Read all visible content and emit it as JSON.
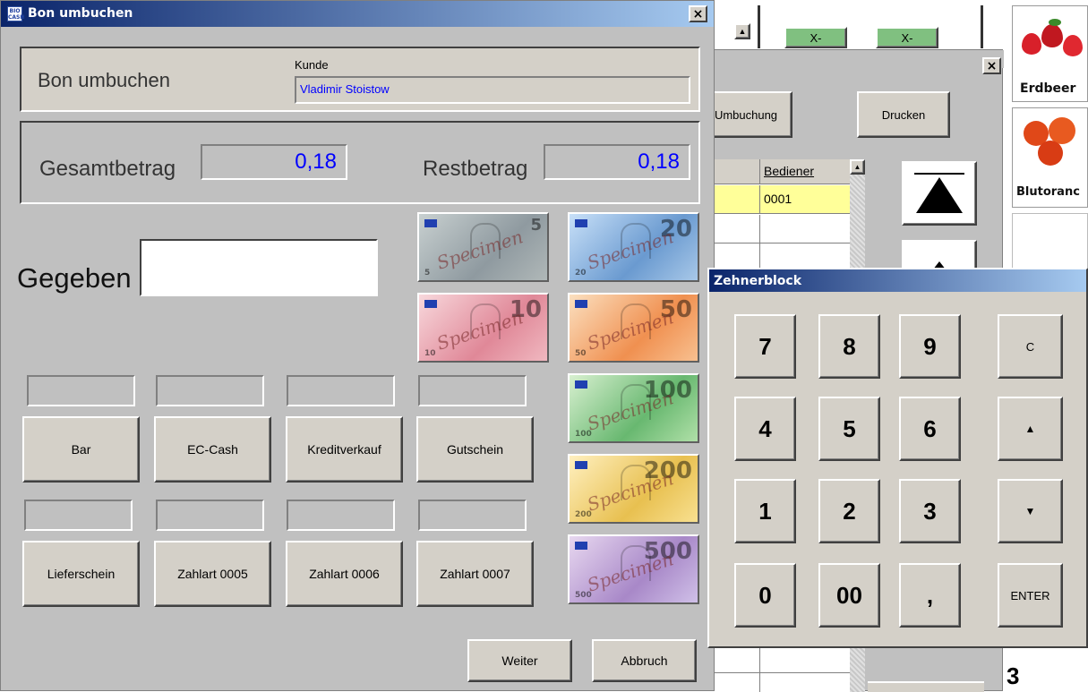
{
  "dialog": {
    "title": "Bon umbuchen",
    "logo": "BIO CASH",
    "close_symbol": "×",
    "heading": "Bon umbuchen",
    "customer_label": "Kunde",
    "customer_value": "Vladimir Stoistow",
    "total_label": "Gesamtbetrag",
    "total_value": "0,18",
    "rest_label": "Restbetrag",
    "rest_value": "0,18",
    "given_label": "Gegeben",
    "given_value": "",
    "payment_row1": [
      "Bar",
      "EC-Cash",
      "Kreditverkauf",
      "Gutschein"
    ],
    "payment_row2": [
      "Lieferschein",
      "Zahlart 0005",
      "Zahlart 0006",
      "Zahlart 0007"
    ],
    "banknotes": [
      {
        "value": "5",
        "label": "5 euro note",
        "color": "#9aa6a8",
        "overlay": "Specimen"
      },
      {
        "value": "20",
        "label": "20 euro note",
        "color": "#7fa7d6",
        "overlay": "Specimen"
      },
      {
        "value": "10",
        "label": "10 euro note",
        "color": "#e8a0a8",
        "overlay": "Specimen"
      },
      {
        "value": "50",
        "label": "50 euro note",
        "color": "#f0a060",
        "overlay": "Specimen"
      },
      {
        "value": "100",
        "label": "100 euro note",
        "color": "#7cc880",
        "overlay": "Specimen"
      },
      {
        "value": "200",
        "label": "200 euro note",
        "color": "#f0d070",
        "overlay": "Specimen"
      },
      {
        "value": "500",
        "label": "500 euro note",
        "color": "#b8a0d0",
        "overlay": "Specimen"
      }
    ],
    "weiter_label": "Weiter",
    "abbruch_label": "Abbruch"
  },
  "background_window": {
    "close_symbol": "×",
    "umbuchung_label": "Umbuchung",
    "drucken_label": "Drucken",
    "column_header": "Bediener",
    "row_value": "0001",
    "top_buttons": [
      "X-",
      "X-"
    ],
    "product_tiles": [
      "Erdbeer",
      "Blutoranc"
    ]
  },
  "numpad": {
    "title": "Zehnerblock",
    "keys": [
      [
        "7",
        "8",
        "9",
        "C"
      ],
      [
        "4",
        "5",
        "6",
        "▲"
      ],
      [
        "1",
        "2",
        "3",
        "▼"
      ],
      [
        "0",
        "00",
        ",",
        "ENTER"
      ]
    ]
  },
  "colors": {
    "window_bg": "#c0c0c0",
    "face": "#d4d0c8",
    "amount_blue": "#0000ff",
    "highlight_row": "#ffff99"
  }
}
